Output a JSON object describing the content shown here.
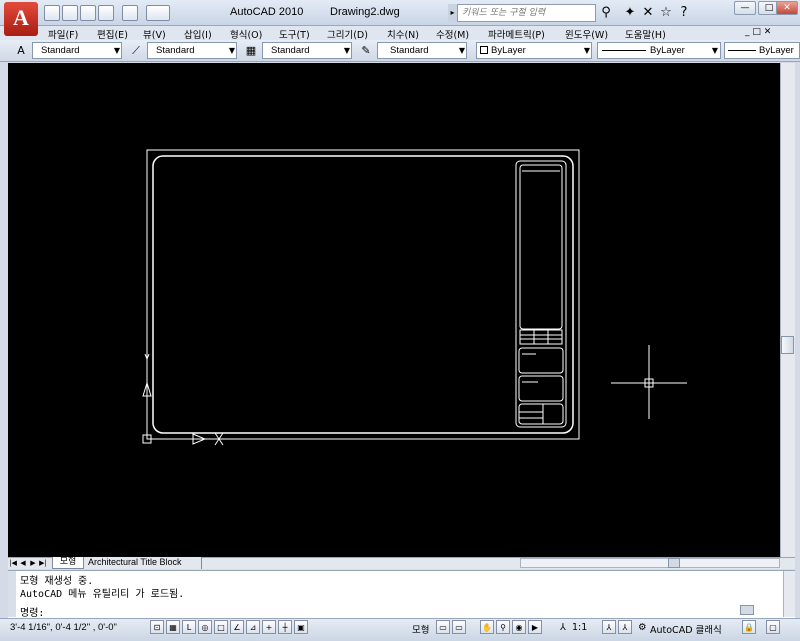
{
  "app": {
    "logo_letter": "A",
    "window_title": "AutoCAD 2010",
    "document_title": "Drawing2.dwg"
  },
  "search": {
    "placeholder": "키워드 또는 구절 입력"
  },
  "menu": {
    "items": [
      "파일(F)",
      "편집(E)",
      "뷰(V)",
      "삽입(I)",
      "형식(O)",
      "도구(T)",
      "그리기(D)",
      "치수(N)",
      "수정(M)",
      "파라메트릭(P)",
      "윈도우(W)",
      "도움말(H)"
    ]
  },
  "styles_toolbar": {
    "text_style": "Standard",
    "dim_style": "Standard",
    "table_style": "Standard",
    "mleader_style": "Standard",
    "color": "ByLayer",
    "linetype": "ByLayer",
    "lineweight": "ByLayer"
  },
  "layout_tabs": {
    "model": "모형",
    "layout": "Architectural Title Block"
  },
  "command_window": {
    "history": [
      "모형 재생성 중.",
      "AutoCAD 메뉴 유틸리티 가 로드됨."
    ],
    "prompt": "명령:"
  },
  "status_bar": {
    "coordinates": "3'-4 1/16\",  0'-4 1/2\" , 0'-0\"",
    "model_label": "모형",
    "annotation_scale": "1:1",
    "workspace": "AutoCAD 클래식"
  },
  "colors": {
    "canvas": "#000000",
    "linework": "#ffffff",
    "chrome": "#d4dbe6",
    "logo_red": "#c62a1c"
  }
}
